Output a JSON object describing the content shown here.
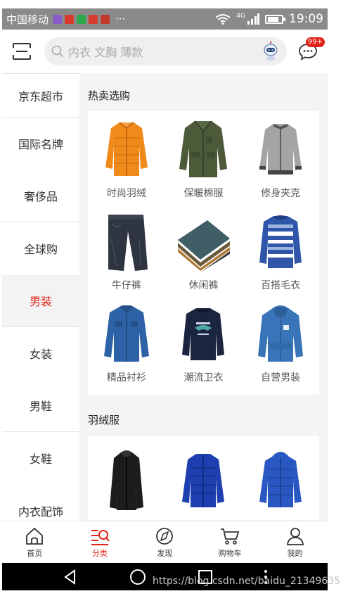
{
  "status_bar": {
    "carrier": "中国移动",
    "notification_icons": [
      "app-icon-purple",
      "app-icon-red",
      "app-icon-green",
      "app-icon-red",
      "app-icon-red"
    ],
    "more": "···",
    "network": "4G",
    "time": "19:09"
  },
  "header": {
    "search_placeholder": "内衣 文胸 薄款",
    "message_badge": "99+"
  },
  "sidebar": {
    "items": [
      {
        "label": "京东超市"
      },
      {
        "label": "国际名牌"
      },
      {
        "label": "奢侈品"
      },
      {
        "label": "全球购"
      },
      {
        "label": "男装",
        "active": true
      },
      {
        "label": "女装"
      },
      {
        "label": "男鞋"
      },
      {
        "label": "女鞋"
      },
      {
        "label": "内衣配饰"
      }
    ]
  },
  "sections": [
    {
      "title": "热卖选购",
      "items": [
        {
          "label": "时尚羽绒",
          "icon": "orange-down-jacket",
          "color": "#f08a1a"
        },
        {
          "label": "保暖棉服",
          "icon": "green-padded-coat",
          "color": "#4c5a3a"
        },
        {
          "label": "修身夹克",
          "icon": "grey-jacket",
          "color": "#9a9a9a"
        },
        {
          "label": "牛仔裤",
          "icon": "jeans",
          "color": "#2e3440"
        },
        {
          "label": "休闲裤",
          "icon": "folded-pants",
          "color": "#3f5e66"
        },
        {
          "label": "百搭毛衣",
          "icon": "striped-sweater",
          "color": "#2f56a8"
        },
        {
          "label": "精品衬衫",
          "icon": "denim-shirt",
          "color": "#2e62a6"
        },
        {
          "label": "潮流卫衣",
          "icon": "navy-sweatshirt",
          "color": "#1c2540"
        },
        {
          "label": "自营男装",
          "icon": "blue-hoodie",
          "color": "#3a74b8"
        }
      ]
    },
    {
      "title": "羽绒服",
      "items": [
        {
          "icon": "black-long-coat",
          "color": "#1c1c1c"
        },
        {
          "icon": "blue-puffer",
          "color": "#1d3fb0"
        },
        {
          "icon": "blue-hooded-puffer",
          "color": "#2a58c2"
        }
      ]
    }
  ],
  "tabbar": {
    "tabs": [
      {
        "label": "首页",
        "icon": "home-icon"
      },
      {
        "label": "分类",
        "icon": "category-icon",
        "active": true
      },
      {
        "label": "发现",
        "icon": "discover-icon"
      },
      {
        "label": "购物车",
        "icon": "cart-icon"
      },
      {
        "label": "我的",
        "icon": "profile-icon"
      }
    ]
  },
  "watermark": "https://blog.csdn.net/baidu_21349635",
  "colors": {
    "accent": "#e2231a",
    "status_bar": "#8a8a8a",
    "nav_bar": "#000000"
  }
}
